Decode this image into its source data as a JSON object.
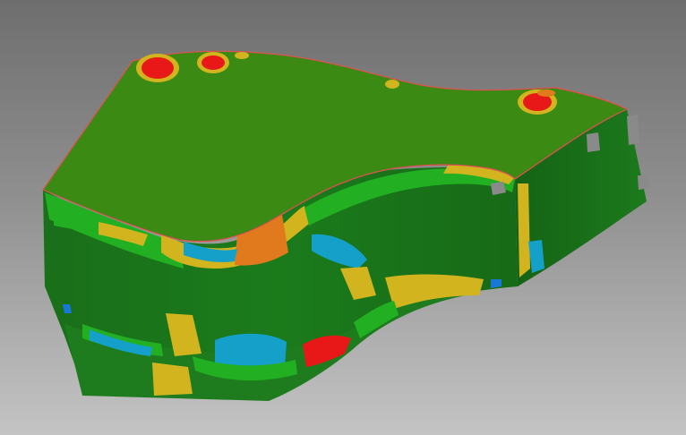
{
  "viewport": {
    "background": "gray-gradient",
    "model": "freeform-part-with-deviation-color-map"
  },
  "colors": {
    "top_face": "#3a8a14",
    "side_face_dark": "#166b16",
    "side_face_mid": "#1f7d1f",
    "deviation_green": "#22b022",
    "deviation_yellow": "#d2b41e",
    "deviation_orange": "#e07a1c",
    "deviation_red": "#e81818",
    "deviation_cyan": "#14a0c8",
    "deviation_blue": "#1878d8",
    "outline": "#e05050"
  }
}
